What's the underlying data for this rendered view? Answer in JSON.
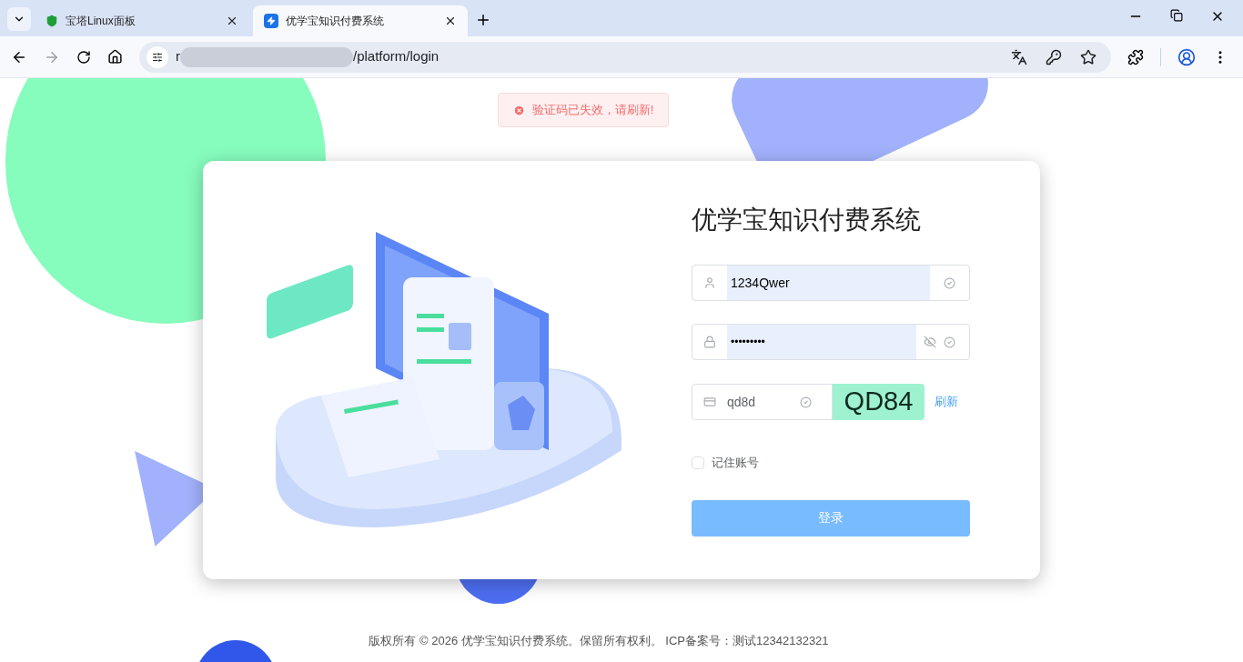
{
  "browser": {
    "tabs": [
      {
        "title": "宝塔Linux面板",
        "selected": false,
        "kind": "panel"
      },
      {
        "title": "优学宝知识付费系统",
        "selected": true,
        "kind": "bolt"
      }
    ],
    "address": {
      "prefix": "r",
      "path": "/platform/login"
    }
  },
  "toast": {
    "message": "验证码已失效，请刷新!"
  },
  "login": {
    "title": "优学宝知识付费系统",
    "username": "1234Qwer",
    "password": "•••••••••",
    "captcha_input": "qd8d",
    "captcha_image": "QD84",
    "refresh": "刷新",
    "remember": {
      "label": "记住账号",
      "checked": false
    },
    "submit": "登录"
  },
  "footer": "版权所有 © 2026 优学宝知识付费系统。保留所有权利。 ICP备案号：测试12342132321"
}
